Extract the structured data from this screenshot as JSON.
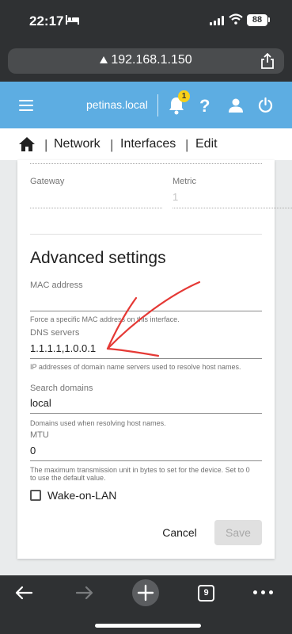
{
  "status_bar": {
    "time": "22:17",
    "battery": "88"
  },
  "browser": {
    "url": "192.168.1.150",
    "tab_count": "9"
  },
  "app": {
    "hostname": "petinas.local",
    "notification_count": "1",
    "help_label": "?",
    "accent_color": "#5dade2",
    "badge_color": "#f7d11a"
  },
  "breadcrumb": {
    "items": [
      "Network",
      "Interfaces",
      "Edit"
    ],
    "separator": "|"
  },
  "form": {
    "gateway": {
      "label": "Gateway",
      "value": ""
    },
    "metric": {
      "label": "Metric",
      "value": "1"
    },
    "section_title": "Advanced settings",
    "mac_address": {
      "label": "MAC address",
      "value": "",
      "hint": "Force a specific MAC address on this interface."
    },
    "dns_servers": {
      "label": "DNS servers",
      "value": "1.1.1.1,1.0.0.1",
      "hint": "IP addresses of domain name servers used to resolve host names."
    },
    "search_domains": {
      "label": "Search domains",
      "value": "local",
      "hint": "Domains used when resolving host names."
    },
    "mtu": {
      "label": "MTU",
      "value": "0",
      "hint": "The maximum transmission unit in bytes to set for the device. Set to 0 to use the default value."
    },
    "wake_on_lan": {
      "label": "Wake-on-LAN",
      "checked": false
    },
    "cancel_label": "Cancel",
    "save_label": "Save"
  },
  "annotation": {
    "color": "#e53935"
  }
}
